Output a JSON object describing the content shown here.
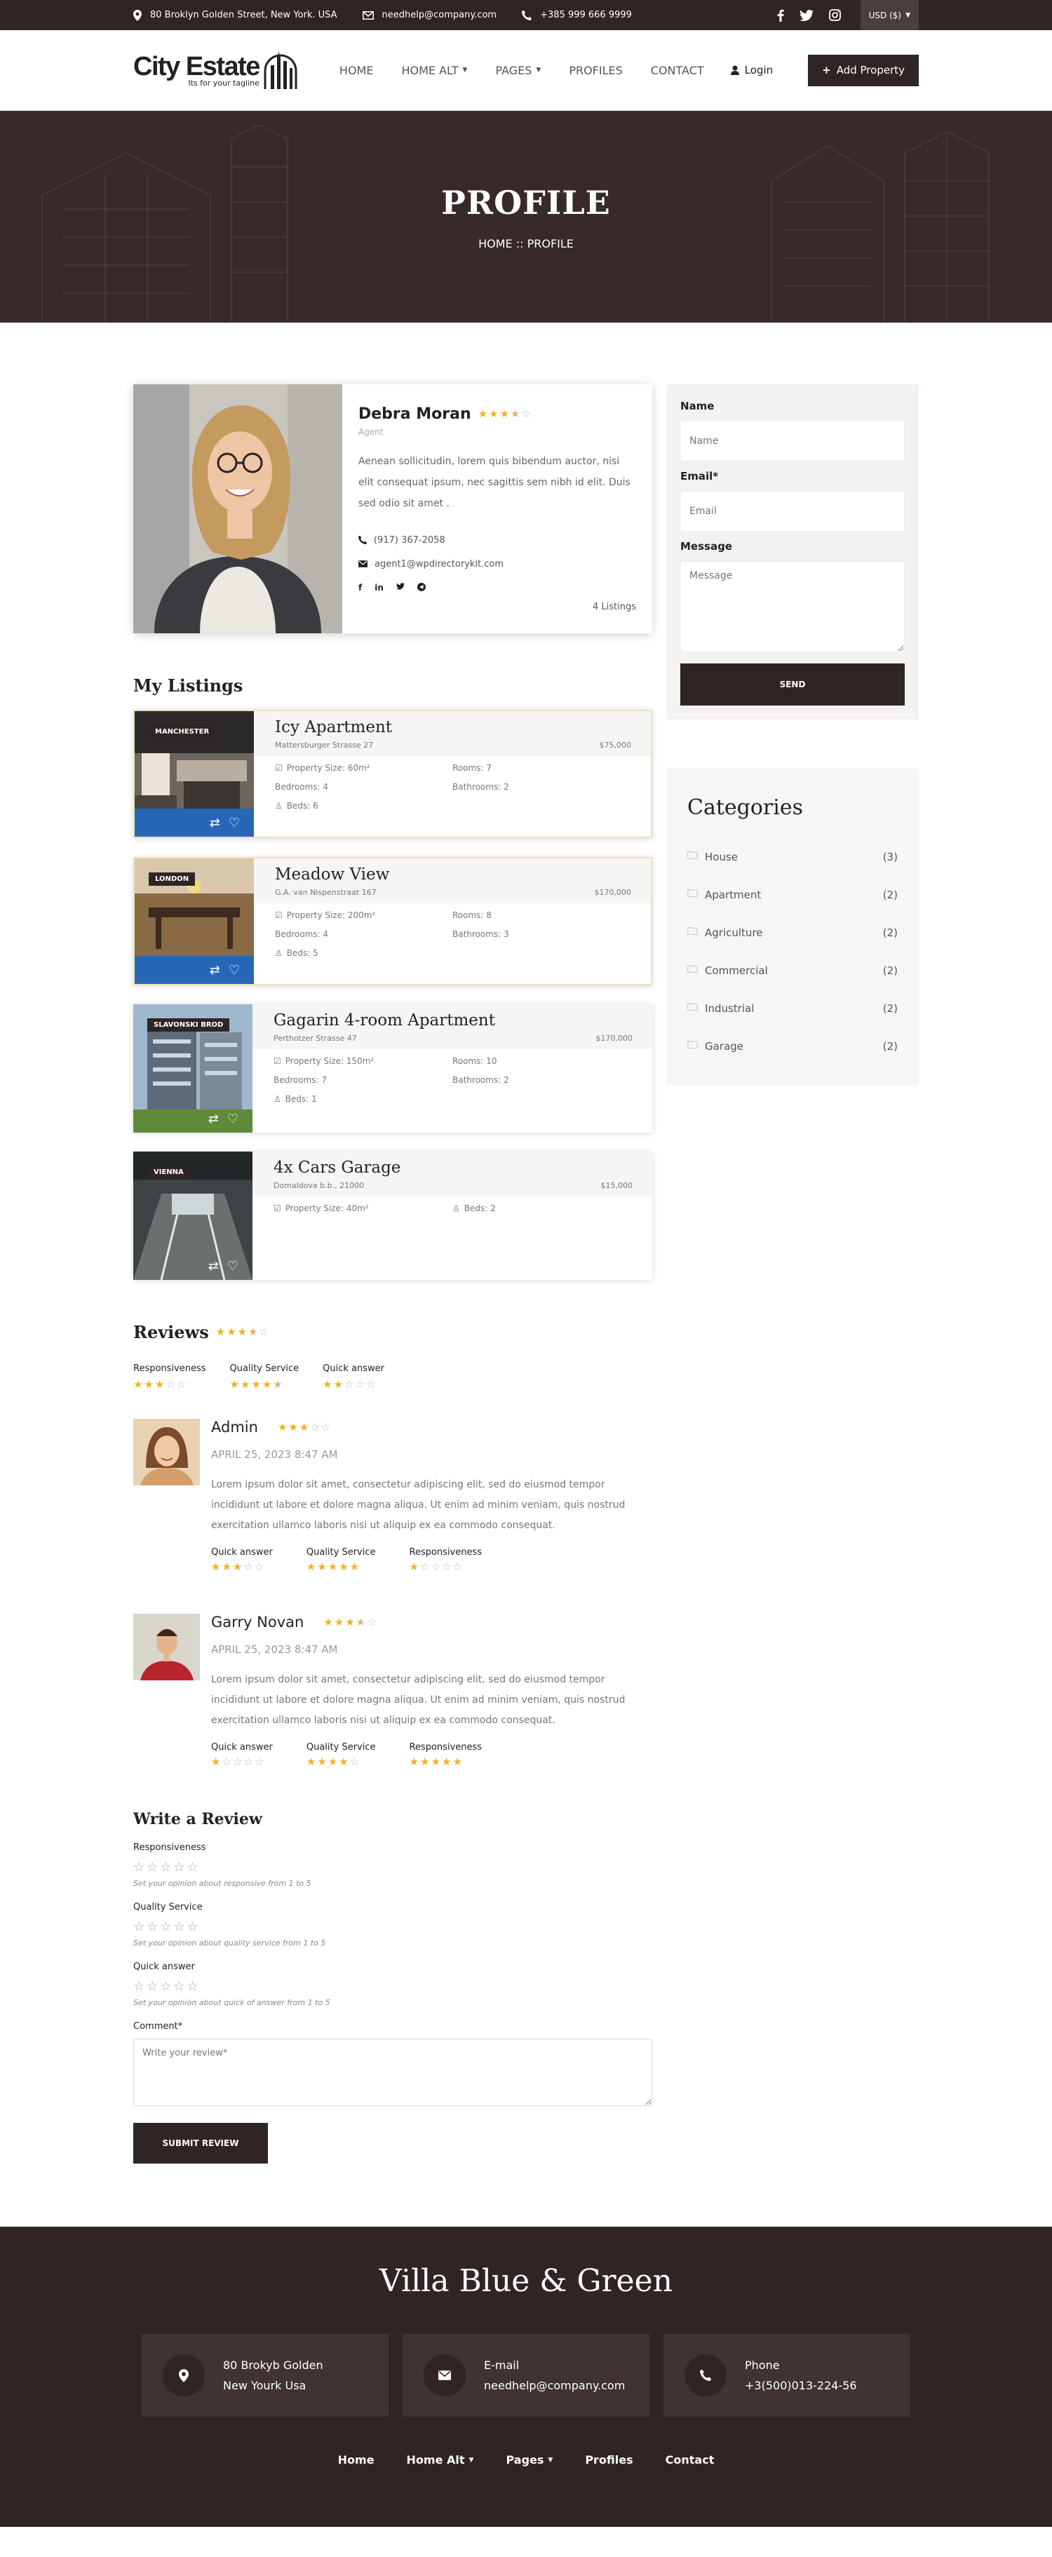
{
  "topbar": {
    "address": "80 Broklyn Golden Street, New York. USA",
    "email": "needhelp@company.com",
    "phone": "+385 999 666 9999",
    "currency": "USD ($)"
  },
  "header": {
    "logo_text": "City Estate",
    "logo_tagline": "Its for your tagline",
    "nav": [
      "HOME",
      "HOME ALT",
      "PAGES",
      "PROFILES",
      "CONTACT"
    ],
    "login": "Login",
    "add_property": "Add Property"
  },
  "hero": {
    "title": "PROFILE",
    "breadcrumb": "HOME :: PROFILE"
  },
  "profile": {
    "name": "Debra Moran",
    "rating": 3.5,
    "role": "Agent",
    "bio": "Aenean sollicitudin, lorem quis bibendum auctor, nisi elit consequat ipsum, nec sagittis sem nibh id elit. Duis sed odio sit amet .",
    "phone": "(917) 367-2058",
    "email": "agent1@wpdirectorykit.com",
    "listings_count": "4 Listings"
  },
  "listings_title": "My Listings",
  "listings": [
    {
      "badge": "MANCHESTER",
      "title": "Icy Apartment",
      "address": "Mattersburger Strasse 27",
      "price": "$75,000",
      "size": "Property Size: 60m²",
      "rooms": "Rooms: 7",
      "bedrooms": "Bedrooms: 4",
      "bathrooms": "Bathrooms: 2",
      "beds": "Beds: 6"
    },
    {
      "badge": "LONDON",
      "title": "Meadow View",
      "address": "G.A. van Nispenstraat 167",
      "price": "$170,000",
      "size": "Property Size: 200m²",
      "rooms": "Rooms: 8",
      "bedrooms": "Bedrooms: 4",
      "bathrooms": "Bathrooms: 3",
      "beds": "Beds: 5"
    },
    {
      "badge": "SLAVONSKI BROD",
      "title": "Gagarin 4-room Apartment",
      "address": "Perthotzer Strasse 47",
      "price": "$170,000",
      "size": "Property Size: 150m²",
      "rooms": "Rooms: 10",
      "bedrooms": "Bedrooms: 7",
      "bathrooms": "Bathrooms: 2",
      "beds": "Beds: 1"
    },
    {
      "badge": "VIENNA",
      "title": "4x Cars Garage",
      "address": "Domaldova b.b., 21000",
      "price": "$15,000",
      "size": "Property Size: 40m²",
      "beds": "Beds: 2"
    }
  ],
  "reviews": {
    "title": "Reviews",
    "overall": 3.5,
    "criteria": [
      {
        "label": "Responsiveness",
        "rating": 3
      },
      {
        "label": "Quality Service",
        "rating": 4.5
      },
      {
        "label": "Quick answer",
        "rating": 2
      }
    ],
    "items": [
      {
        "name": "Admin",
        "rating": 3,
        "date": "APRIL 25, 2023 8:47 AM",
        "text": "Lorem ipsum dolor sit amet, consectetur adipiscing elit, sed do eiusmod tempor incididunt ut labore et dolore magna aliqua. Ut enim ad minim veniam, quis nostrud exercitation ullamco laboris nisi ut aliquip ex ea commodo consequat.",
        "criteria": [
          {
            "label": "Quick answer",
            "rating": 3
          },
          {
            "label": "Quality Service",
            "rating": 5
          },
          {
            "label": "Responsiveness",
            "rating": 1
          }
        ]
      },
      {
        "name": "Garry Novan",
        "rating": 3.5,
        "date": "APRIL 25, 2023 8:47 AM",
        "text": "Lorem ipsum dolor sit amet, consectetur adipiscing elit, sed do eiusmod tempor incididunt ut labore et dolore magna aliqua. Ut enim ad minim veniam, quis nostrud exercitation ullamco laboris nisi ut aliquip ex ea commodo consequat.",
        "criteria": [
          {
            "label": "Quick answer",
            "rating": 1
          },
          {
            "label": "Quality Service",
            "rating": 4
          },
          {
            "label": "Responsiveness",
            "rating": 5
          }
        ]
      }
    ]
  },
  "write_review": {
    "title": "Write a Review",
    "groups": [
      {
        "label": "Responsiveness",
        "hint": "Set your opinion about responsive from 1 to 5"
      },
      {
        "label": "Quality Service",
        "hint": "Set your opinion about quality service from 1 to 5"
      },
      {
        "label": "Quick answer",
        "hint": "Set your opinion about quick of answer from 1 to 5"
      }
    ],
    "comment_label": "Comment*",
    "comment_placeholder": "Write your review*",
    "submit": "SUBMIT REVIEW"
  },
  "contact_form": {
    "name_label": "Name",
    "name_placeholder": "Name",
    "email_label": "Email*",
    "email_placeholder": "Email",
    "message_label": "Message",
    "message_placeholder": "Message",
    "send": "SEND"
  },
  "categories": {
    "title": "Categories",
    "items": [
      {
        "label": "House",
        "count": "(3)"
      },
      {
        "label": "Apartment",
        "count": "(2)"
      },
      {
        "label": "Agriculture",
        "count": "(2)"
      },
      {
        "label": "Commercial",
        "count": "(2)"
      },
      {
        "label": "Industrial",
        "count": "(2)"
      },
      {
        "label": "Garage",
        "count": "(2)"
      }
    ]
  },
  "footer": {
    "title": "Villa Blue & Green",
    "address_l1": "80 Brokyb Golden",
    "address_l2": "New Yourk Usa",
    "email_label": "E-mail",
    "email": "needhelp@company.com",
    "phone_label": "Phone",
    "phone": "+3(500)013-224-56",
    "nav": [
      "Home",
      "Home Alt",
      "Pages",
      "Profiles",
      "Contact"
    ]
  },
  "colors": {
    "primary": "#2f2524",
    "star": "#f2b01e",
    "blue_bar": "#2667b8"
  }
}
